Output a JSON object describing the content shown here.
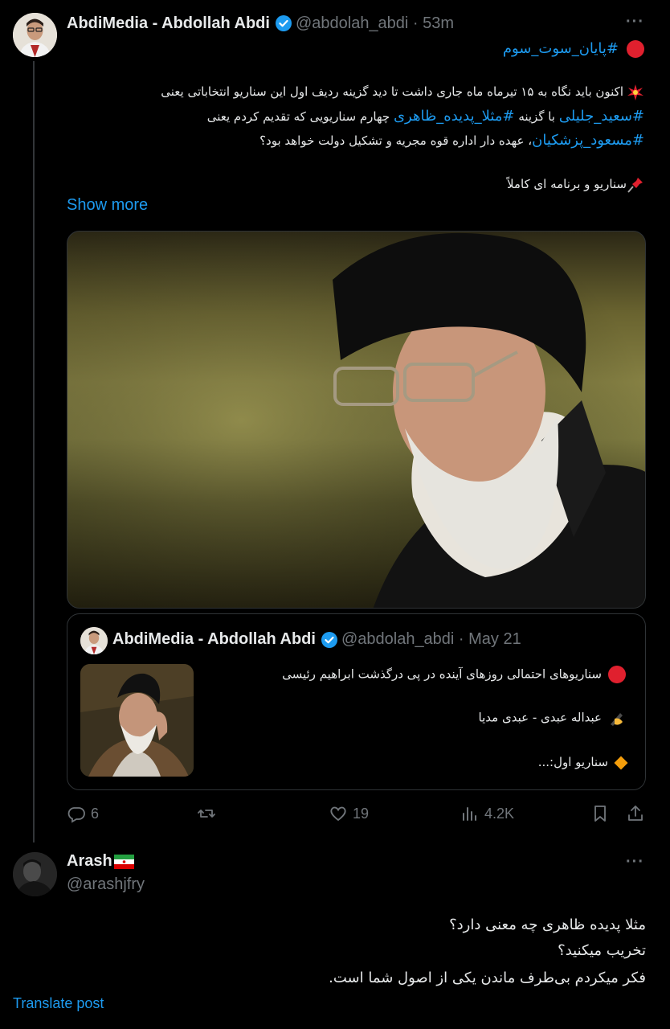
{
  "tweet": {
    "author_name": "AbdiMedia - Abdollah Abdi",
    "author_handle": "@abdolah_abdi · 53m",
    "more": "···",
    "hashtag_line": "#پایان_سوت_سوم",
    "body_lines": [
      "اکنون باید نگاه به ۱۵ تیرماه ماه جاری داشت تا دید گزینه ردیف اول این سناریو انتخاباتی یعنی",
      "با گزینه",
      "چهارم سناریویی که تقدیم کردم یعنی",
      "، عهده دار اداره قوه مجریه و تشکیل دولت خواهد بود؟",
      "سناریو و برنامه ای کاملاً"
    ],
    "hashtags": [
      "#سعید_جلیلی",
      "#مثلا_پدیده_ظاهری",
      "#مسعود_پزشکیان"
    ],
    "show_more": "Show more"
  },
  "quote": {
    "author_name": "AbdiMedia - Abdollah Abdi",
    "author_handle": "@abdolah_abdi · May 21",
    "lines": [
      "سناریوهای احتمالی روزهای آینده در پی درگذشت ابراهیم رئیسی",
      "عبداله عبدی - عبدی مدیا",
      "سناریو اول:..."
    ]
  },
  "actions": {
    "replies": "6",
    "likes": "19",
    "views": "4.2K"
  },
  "reply": {
    "author_name": "Arash",
    "author_handle": "@arashjfry",
    "more": "···",
    "lines": [
      "مثلا پدیده ظاهری چه معنی دارد؟",
      "تخریب میکنید؟",
      "فکر میکردم بی‌طرف ماندن یکی از اصول شما است."
    ],
    "translate": "Translate post"
  },
  "colors": {
    "background": "#000000",
    "text": "#e7e9ea",
    "secondary": "#71767b",
    "accent": "#1d9bf0",
    "border": "#2f3336"
  },
  "icons": [
    "verified-badge-icon",
    "more-icon",
    "reply-icon",
    "retweet-icon",
    "like-icon",
    "views-icon",
    "bookmark-icon",
    "share-icon",
    "red-circle-emoji",
    "collision-emoji",
    "pin-emoji",
    "writing-hand-emoji",
    "orange-diamond-emoji",
    "iran-flag-emoji"
  ]
}
